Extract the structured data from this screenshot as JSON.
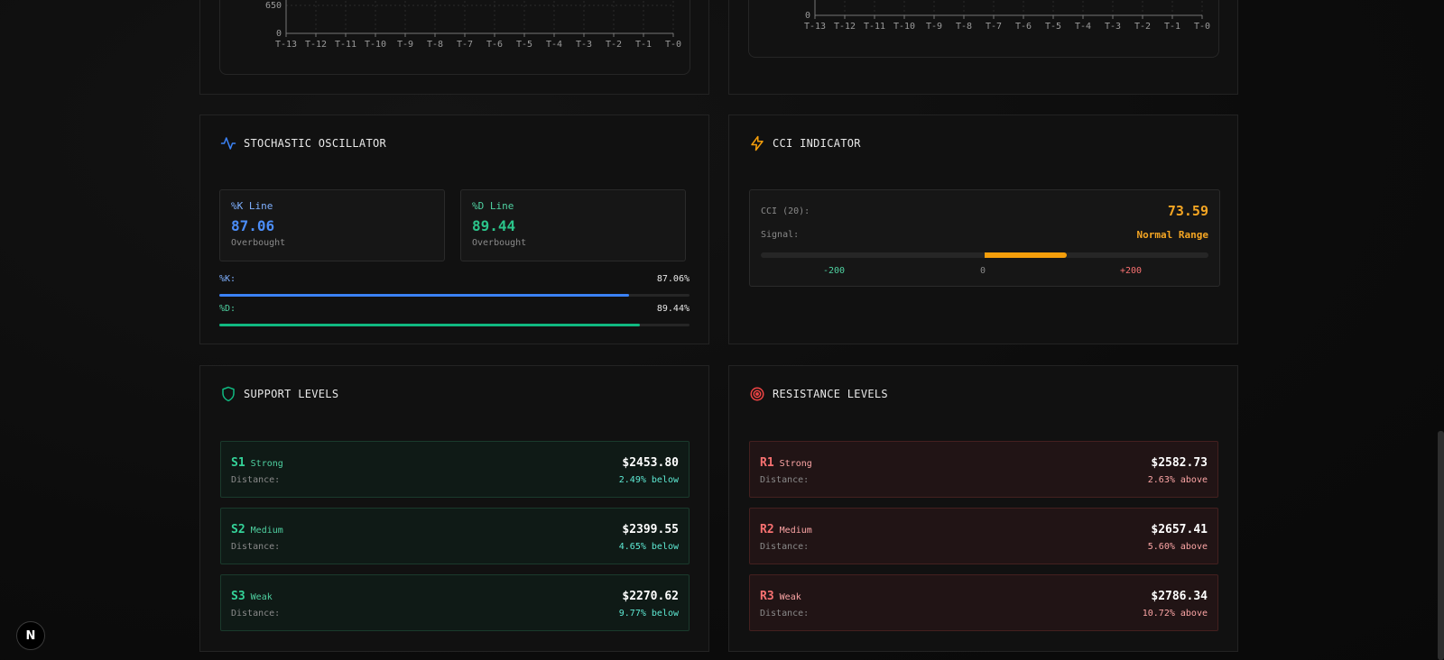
{
  "volume_chart_left": {
    "y_ticks": [
      "650",
      "0"
    ],
    "x_ticks": [
      "T-13",
      "T-12",
      "T-11",
      "T-10",
      "T-9",
      "T-8",
      "T-7",
      "T-6",
      "T-5",
      "T-4",
      "T-3",
      "T-2",
      "T-1",
      "T-0"
    ]
  },
  "volume_chart_right": {
    "y_ticks": [
      "0"
    ],
    "x_ticks": [
      "T-13",
      "T-12",
      "T-11",
      "T-10",
      "T-9",
      "T-8",
      "T-7",
      "T-6",
      "T-5",
      "T-4",
      "T-3",
      "T-2",
      "T-1",
      "T-0"
    ]
  },
  "stochastic": {
    "title": "STOCHASTIC OSCILLATOR",
    "k": {
      "label": "%K Line",
      "value": "87.06",
      "status": "Overbought",
      "bar_label": "%K:",
      "bar_pct": "87.06%",
      "fill": 87.06,
      "color": "#3b82f6"
    },
    "d": {
      "label": "%D Line",
      "value": "89.44",
      "status": "Overbought",
      "bar_label": "%D:",
      "bar_pct": "89.44%",
      "fill": 89.44,
      "color": "#10b981"
    }
  },
  "cci": {
    "title": "CCI INDICATOR",
    "label": "CCI (20):",
    "value": "73.59",
    "value_num": 73.59,
    "signal_label": "Signal:",
    "signal": "Normal Range",
    "scale_min": "-200",
    "scale_mid": "0",
    "scale_max": "+200",
    "color": "#f59e0b"
  },
  "support": {
    "title": "SUPPORT LEVELS",
    "distance_label": "Distance:",
    "levels": [
      {
        "id": "S1",
        "strength": "Strong",
        "price": "$2453.80",
        "distance": "2.49% below"
      },
      {
        "id": "S2",
        "strength": "Medium",
        "price": "$2399.55",
        "distance": "4.65% below"
      },
      {
        "id": "S3",
        "strength": "Weak",
        "price": "$2270.62",
        "distance": "9.77% below"
      }
    ]
  },
  "resistance": {
    "title": "RESISTANCE LEVELS",
    "distance_label": "Distance:",
    "levels": [
      {
        "id": "R1",
        "strength": "Strong",
        "price": "$2582.73",
        "distance": "2.63% above"
      },
      {
        "id": "R2",
        "strength": "Medium",
        "price": "$2657.41",
        "distance": "5.60% above"
      },
      {
        "id": "R3",
        "strength": "Weak",
        "price": "$2786.34",
        "distance": "10.72% above"
      }
    ]
  },
  "next_badge": "N"
}
